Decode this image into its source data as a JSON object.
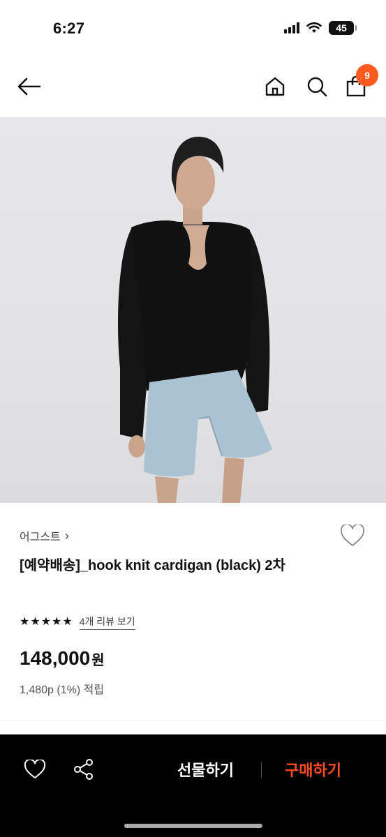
{
  "status_bar": {
    "time": "6:27",
    "battery": "45"
  },
  "header": {
    "cart_count": "9"
  },
  "product": {
    "brand": "어그스트",
    "brand_chevron": "›",
    "title": "[예약배송]_hook knit cardigan (black) 2차",
    "rating_stars": 5,
    "review_link": "4개 리뷰 보기",
    "price": "148,000",
    "price_unit": "원",
    "points": "1,480p (1%) 적립"
  },
  "bottom_bar": {
    "gift_label": "선물하기",
    "buy_label": "구매하기"
  },
  "colors": {
    "accent": "#ff5a1f",
    "buy": "#ff4b1f",
    "bar_bg": "#000000"
  },
  "icons": {
    "back": "arrow-left-icon",
    "home": "home-icon",
    "search": "search-icon",
    "cart": "shopping-bag-icon",
    "wishlist": "heart-icon",
    "share": "share-icon",
    "star": "star-icon",
    "signal": "cellular-signal-icon",
    "wifi": "wifi-icon",
    "battery": "battery-icon"
  }
}
